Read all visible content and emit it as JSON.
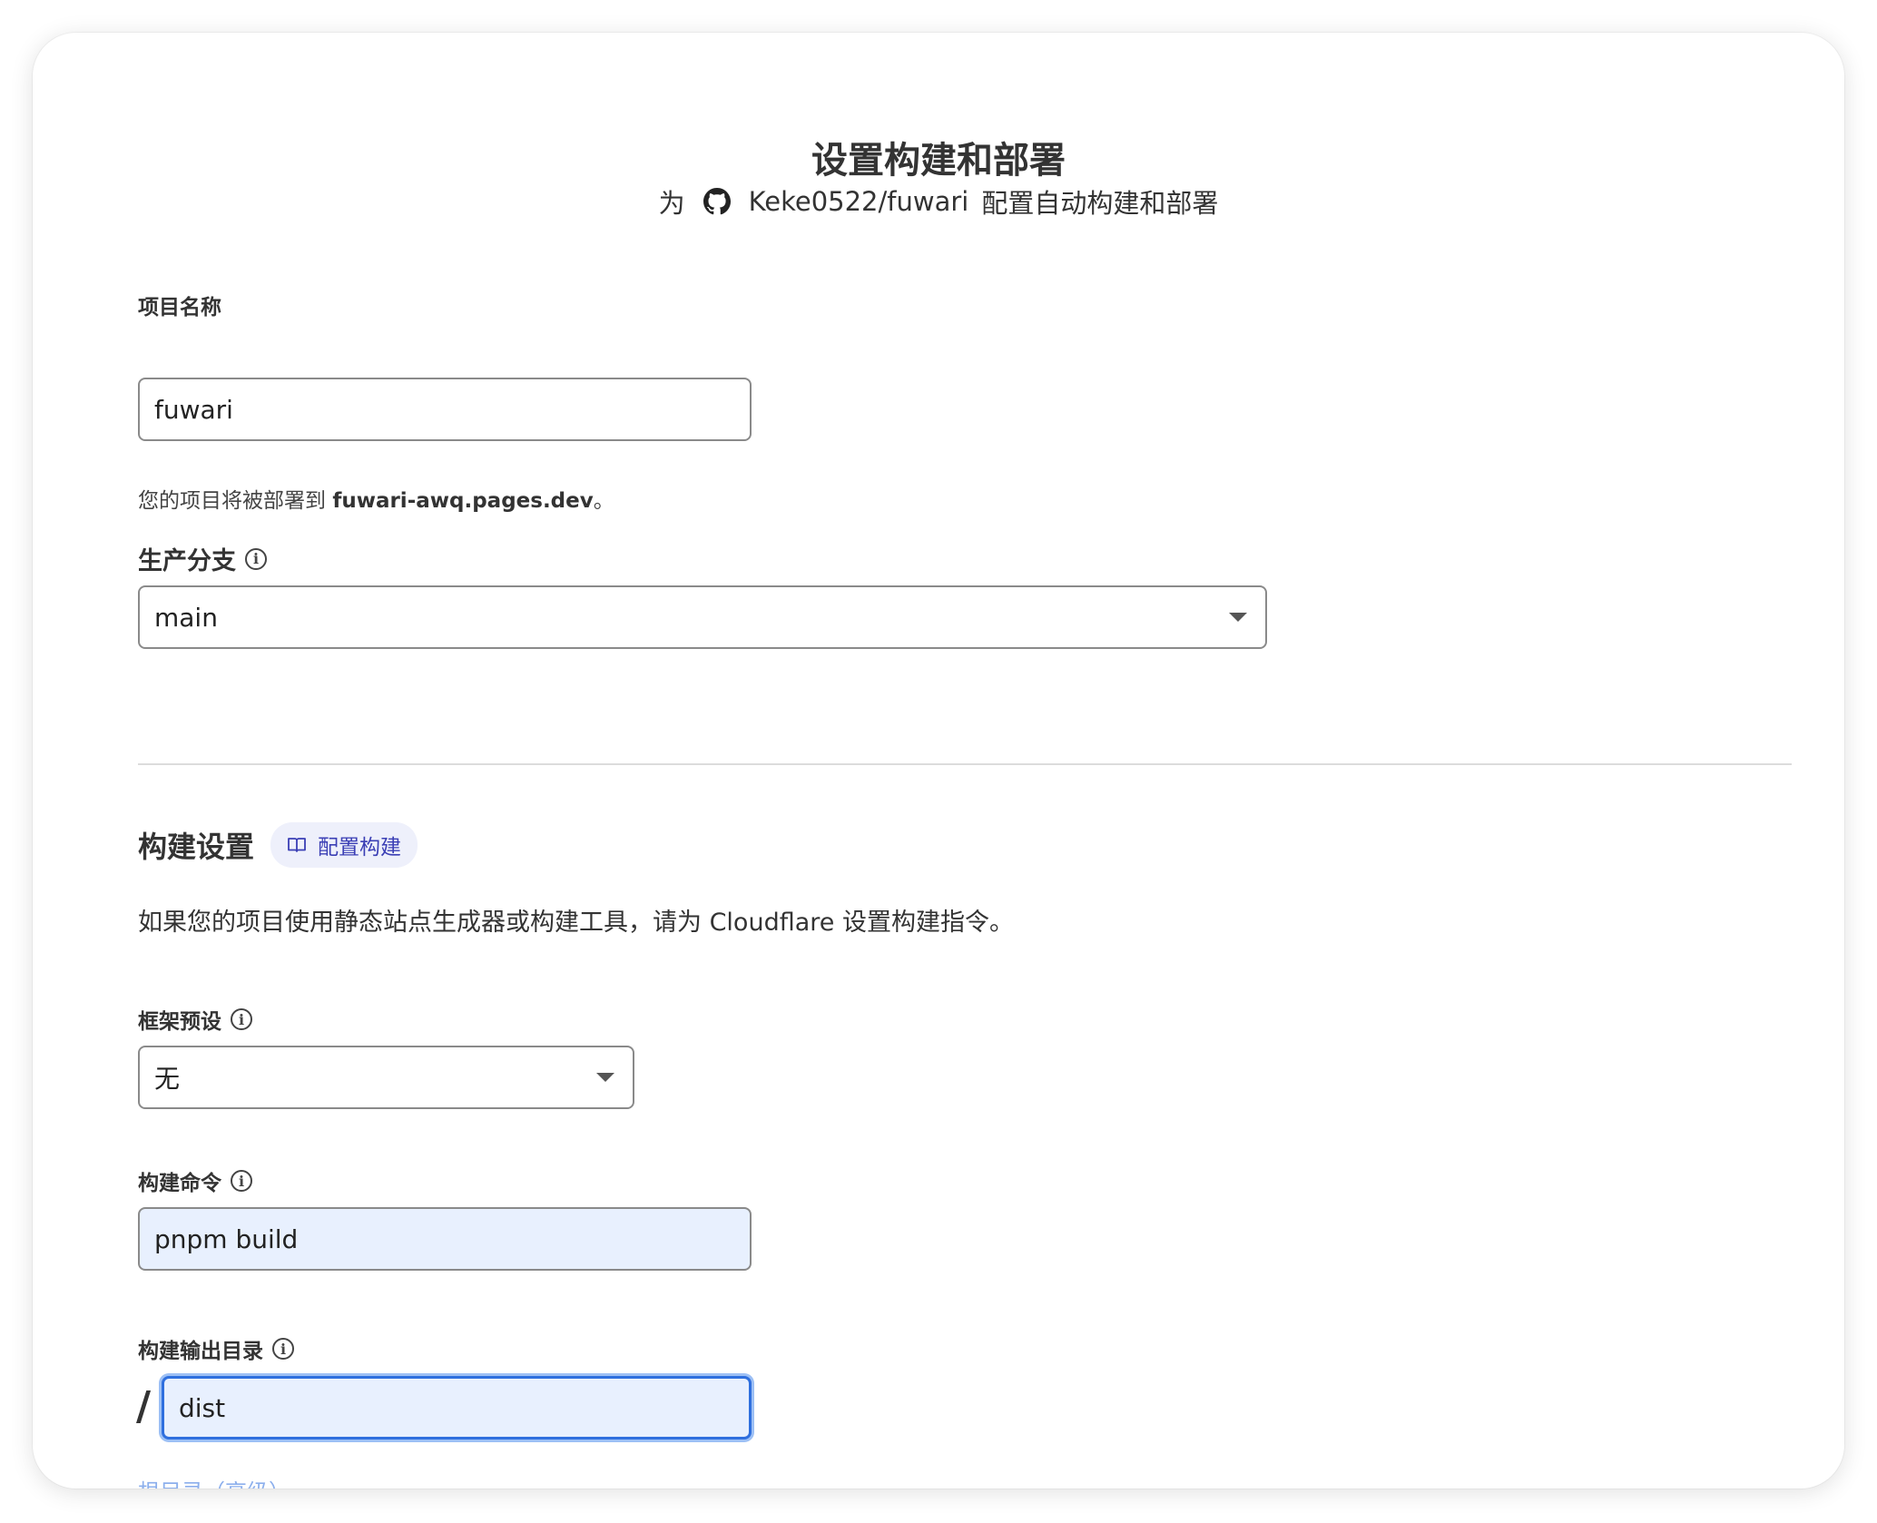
{
  "header": {
    "title": "设置构建和部署",
    "subtitle_prefix": "为",
    "repo": "Keke0522/fuwari",
    "subtitle_suffix": "配置自动构建和部署",
    "repo_icon": "github-icon"
  },
  "project": {
    "label": "项目名称",
    "value": "fuwari",
    "hint_prefix": "您的项目将被部署到",
    "hint_domain": "fuwari-awq.pages.dev",
    "hint_suffix": "。"
  },
  "branch": {
    "label": "生产分支",
    "value": "main"
  },
  "build_settings": {
    "title": "构建设置",
    "pill_label": "配置构建",
    "pill_icon": "book-icon",
    "description": "如果您的项目使用静态站点生成器或构建工具，请为 Cloudflare 设置构建指令。"
  },
  "framework": {
    "label": "框架预设",
    "value": "无"
  },
  "build_command": {
    "label": "构建命令",
    "value": "pnpm build"
  },
  "output_dir": {
    "label": "构建输出目录",
    "prefix": "/",
    "value": "dist"
  },
  "root_dir_link": {
    "label": "根目录（高级）"
  },
  "colors": {
    "accent": "#2f6fde",
    "pill_bg": "#eef0fb",
    "pill_text": "#3b3fb5",
    "filled_bg": "#e8f0fe"
  }
}
